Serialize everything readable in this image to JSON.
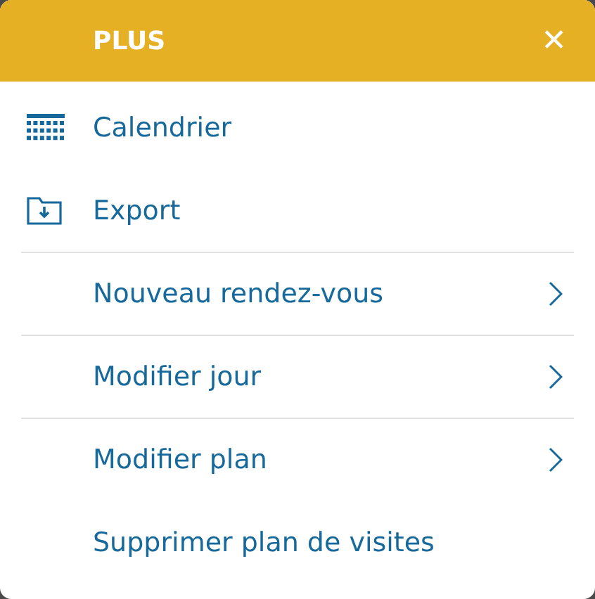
{
  "header": {
    "title": "PLUS",
    "close": "✕"
  },
  "items": [
    {
      "label": "Calendrier",
      "kind": "calendar",
      "divider_after": false
    },
    {
      "label": "Export",
      "kind": "folder",
      "divider_after": true
    },
    {
      "label": "Nouveau rendez-vous",
      "kind": "submenu",
      "divider_after": true
    },
    {
      "label": "Modifier jour",
      "kind": "submenu",
      "divider_after": true
    },
    {
      "label": "Modifier plan",
      "kind": "submenu",
      "divider_after": false
    },
    {
      "label": "Supprimer plan de visites",
      "kind": "plain",
      "divider_after": false
    }
  ]
}
